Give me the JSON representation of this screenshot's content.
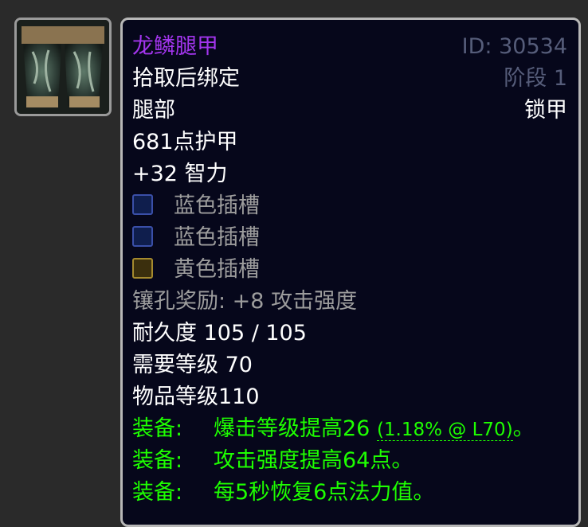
{
  "item": {
    "name": "龙鳞腿甲",
    "name_color": "#a335ee",
    "id_text": "ID: 30534",
    "bind": "拾取后绑定",
    "phase": "阶段 1",
    "slot": "腿部",
    "armor_type": "锁甲",
    "armor": "681点护甲",
    "stat_intellect": "+32 智力",
    "sockets": [
      {
        "label": "蓝色插槽",
        "color": "blue",
        "icon": "blue-socket-icon"
      },
      {
        "label": "蓝色插槽",
        "color": "blue",
        "icon": "blue-socket-icon"
      },
      {
        "label": "黄色插槽",
        "color": "yellow",
        "icon": "yellow-socket-icon"
      }
    ],
    "socket_bonus": "镶孔奖励: +8 攻击强度",
    "durability": "耐久度 105 / 105",
    "required_level": "需要等级 70",
    "item_level": "物品等级110",
    "equip_label": "装备:",
    "equip_effects": [
      {
        "text": "爆击等级提高26",
        "rating": "(1.18% @ L70)",
        "suffix": "。"
      },
      {
        "text": "攻击强度提高64点。"
      },
      {
        "text": "每5秒恢复6点法力值。"
      }
    ],
    "icon": "dragonscale-legguards-icon",
    "green_color": "#1eff00",
    "grey_color": "#9d9d9d"
  }
}
